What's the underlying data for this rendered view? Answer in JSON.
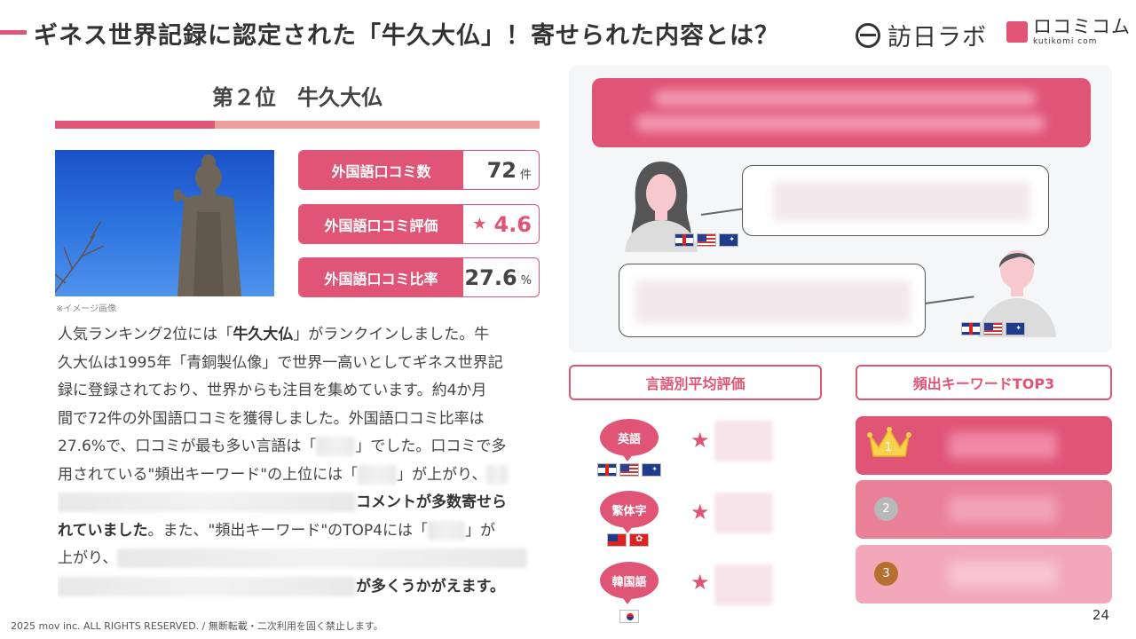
{
  "header": {
    "title": "ギネス世界記録に認定された「牛久大仏」！寄せられた内容とは？",
    "logo_houjin": "訪日ラボ",
    "logo_kutikomi": "ロコミコム",
    "logo_kutikomi_sub": "kutikomi com"
  },
  "rank": {
    "title": "第２位　牛久大仏"
  },
  "image": {
    "caption": "※イメージ画像"
  },
  "stats": [
    {
      "label": "外国語口コミ数",
      "value": "72",
      "unit": "件"
    },
    {
      "label": "外国語口コミ評価",
      "value": "4.6",
      "icon": "star-icon"
    },
    {
      "label": "外国語口コミ比率",
      "value": "27.6",
      "unit": "%"
    }
  ],
  "body": {
    "l1": "人気ランキング2位には「",
    "l1_bold": "牛久大仏",
    "l1_end": "」がランクインしました。牛",
    "l2": "久大仏は1995年「青銅製仏像」で世界一高いとしてギネス世界記",
    "l3": "録に登録されており、世界からも注目を集めています。約4か月",
    "l4": "間で72件の外国語口コミを獲得しました。外国語口コミ比率は",
    "l5a": "27.6%で、口コミが最も多い言語は「",
    "l5b": "」でした。口コミで多",
    "l6a": "用されている\"頻出キーワード\"の上位には「",
    "l6b": "」が上がり、",
    "l7_bold": "コメントが多数寄せら",
    "l8_bold": "れていました",
    "l8": "。また、\"頻出キーワード\"のTOP4には「",
    "l8_end": "」が",
    "l9": "上がり、",
    "l10_bold": "が多くうかがえます。"
  },
  "footer": {
    "copyright": "2025 mov inc. ALL RIGHTS RESERVED. / 無断転載・二次利用を固く禁止します。",
    "page": "24"
  },
  "sections": {
    "lang_avg": "言語別平均評価",
    "keywords": "頻出キーワードTOP3"
  },
  "languages": [
    {
      "name": "英語",
      "flags": [
        "uk-flag",
        "us-flag",
        "au-flag"
      ]
    },
    {
      "name": "繁体字",
      "flags": [
        "tw-flag",
        "hk-flag"
      ]
    },
    {
      "name": "韓国語",
      "flags": [
        "kr-flag"
      ]
    }
  ],
  "keywords": [
    {
      "rank": "1",
      "icon": "crown-icon"
    },
    {
      "rank": "2"
    },
    {
      "rank": "3"
    }
  ],
  "colors": {
    "accent": "#e05475",
    "accent_light": "#ec9c9c",
    "kw2": "#ea7f98",
    "kw3": "#f2a8ba",
    "silver": "#b8b8b8",
    "bronze": "#b5702f"
  }
}
